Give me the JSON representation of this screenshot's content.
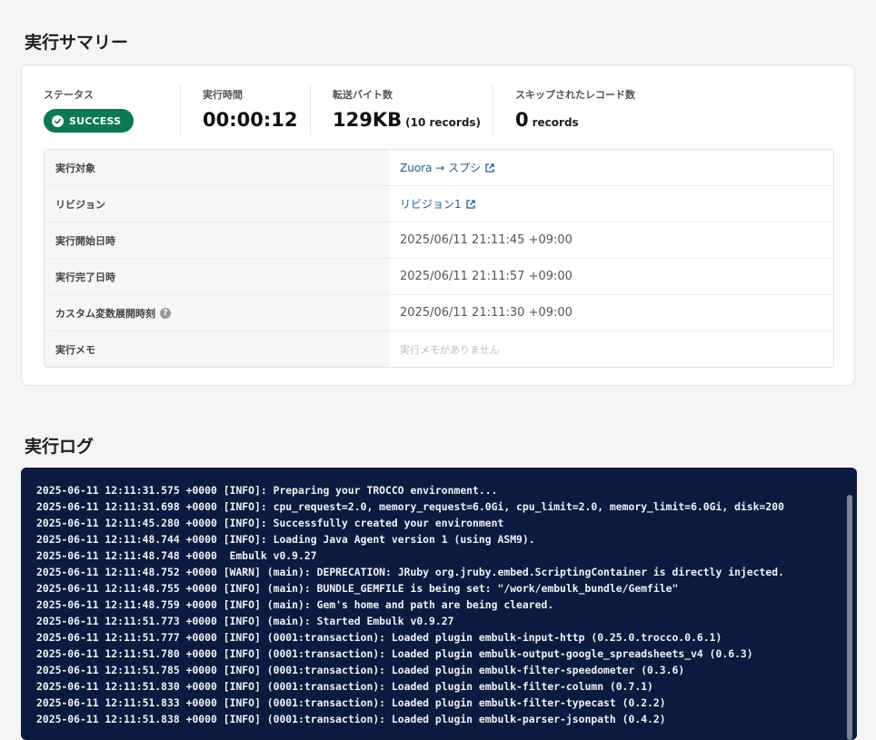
{
  "summary": {
    "title": "実行サマリー",
    "stats": {
      "status_label": "ステータス",
      "status_value": "SUCCESS",
      "duration_label": "実行時間",
      "duration_value": "00:00:12",
      "bytes_label": "転送バイト数",
      "bytes_value": "129KB",
      "bytes_records": "(10 records)",
      "skipped_label": "スキップされたレコード数",
      "skipped_value": "0",
      "skipped_unit": "records"
    },
    "details": {
      "target_label": "実行対象",
      "target_value": "Zuora → スプシ",
      "revision_label": "リビジョン",
      "revision_value": "リビジョン1",
      "start_label": "実行開始日時",
      "start_value": "2025/06/11 21:11:45 +09:00",
      "end_label": "実行完了日時",
      "end_value": "2025/06/11 21:11:57 +09:00",
      "custom_var_label": "カスタム変数展開時刻",
      "custom_var_value": "2025/06/11 21:11:30 +09:00",
      "memo_label": "実行メモ",
      "memo_placeholder": "実行メモがありません"
    }
  },
  "log": {
    "title": "実行ログ",
    "lines": [
      "2025-06-11 12:11:31.575 +0000 [INFO]: Preparing your TROCCO environment...",
      "2025-06-11 12:11:31.698 +0000 [INFO]: cpu_request=2.0, memory_request=6.0Gi, cpu_limit=2.0, memory_limit=6.0Gi, disk=200",
      "2025-06-11 12:11:45.280 +0000 [INFO]: Successfully created your environment",
      "2025-06-11 12:11:48.744 +0000 [INFO]: Loading Java Agent version 1 (using ASM9).",
      "2025-06-11 12:11:48.748 +0000  Embulk v0.9.27",
      "2025-06-11 12:11:48.752 +0000 [WARN] (main): DEPRECATION: JRuby org.jruby.embed.ScriptingContainer is directly injected.",
      "2025-06-11 12:11:48.755 +0000 [INFO] (main): BUNDLE_GEMFILE is being set: \"/work/embulk_bundle/Gemfile\"",
      "2025-06-11 12:11:48.759 +0000 [INFO] (main): Gem's home and path are being cleared.",
      "2025-06-11 12:11:51.773 +0000 [INFO] (main): Started Embulk v0.9.27",
      "2025-06-11 12:11:51.777 +0000 [INFO] (0001:transaction): Loaded plugin embulk-input-http (0.25.0.trocco.0.6.1)",
      "2025-06-11 12:11:51.780 +0000 [INFO] (0001:transaction): Loaded plugin embulk-output-google_spreadsheets_v4 (0.6.3)",
      "2025-06-11 12:11:51.785 +0000 [INFO] (0001:transaction): Loaded plugin embulk-filter-speedometer (0.3.6)",
      "2025-06-11 12:11:51.830 +0000 [INFO] (0001:transaction): Loaded plugin embulk-filter-column (0.7.1)",
      "2025-06-11 12:11:51.833 +0000 [INFO] (0001:transaction): Loaded plugin embulk-filter-typecast (0.2.2)",
      "2025-06-11 12:11:51.838 +0000 [INFO] (0001:transaction): Loaded plugin embulk-parser-jsonpath (0.4.2)"
    ]
  },
  "colors": {
    "success": "#0b7a52",
    "link": "#1a5fa8",
    "log_background": "#0b1b3f"
  }
}
